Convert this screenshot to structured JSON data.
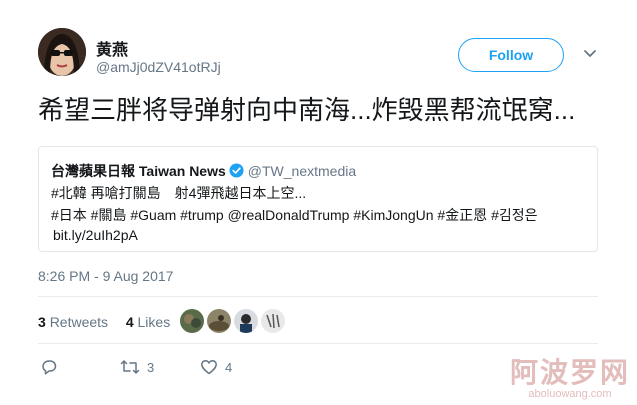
{
  "user": {
    "display_name": "黄燕",
    "handle": "@amJj0dZV41otRJj",
    "avatar_icon": "user-avatar"
  },
  "follow_button": {
    "label": "Follow"
  },
  "caret_icon": "chevron-down-icon",
  "tweet_text": "希望三胖将导弹射向中南海...炸毁黑帮流氓窝...",
  "quoted_tweet": {
    "name": "台灣蘋果日報 Taiwan News",
    "verified_icon": "verified-badge-icon",
    "handle": "@TW_nextmedia",
    "line1": "#北韓 再嗆打關島　射4彈飛越日本上空...",
    "line2": "#日本 #關島 #Guam #trump @realDonaldTrump #KimJongUn #金正恩 #김정은",
    "link": "bit.ly/2uIh2pA"
  },
  "timestamp": "8:26 PM - 9 Aug 2017",
  "stats": {
    "retweets_count": "3",
    "retweets_label": "Retweets",
    "likes_count": "4",
    "likes_label": "Likes"
  },
  "actions": {
    "reply_icon": "reply-icon",
    "retweet_icon": "retweet-icon",
    "retweet_count": "3",
    "like_icon": "heart-icon",
    "like_count": "4"
  },
  "watermark": {
    "main": "阿波罗网",
    "sub": "aboluowang.com"
  },
  "colors": {
    "accent": "#1da1f2",
    "muted": "#657786",
    "text": "#14171a",
    "border": "#e1e8ed",
    "watermark": "#e3bcbc"
  }
}
